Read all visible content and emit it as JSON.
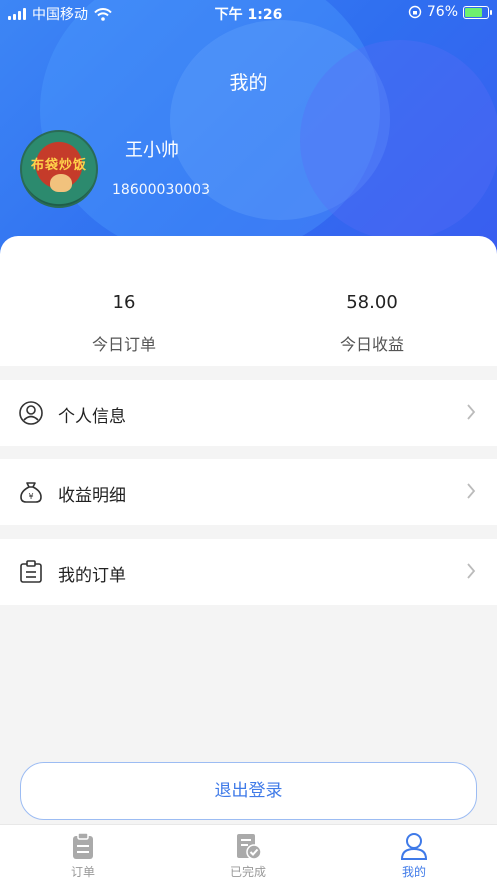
{
  "status_bar": {
    "carrier": "中国移动",
    "time": "下午 1:26",
    "battery": "76%"
  },
  "header": {
    "title": "我的"
  },
  "user": {
    "avatar_text": "布袋炒饭",
    "name": "王小帅",
    "phone": "18600030003"
  },
  "stats": [
    {
      "value": "16",
      "label": "今日订单"
    },
    {
      "value": "58.00",
      "label": "今日收益"
    }
  ],
  "menu": [
    {
      "label": "个人信息",
      "icon": "user-circle-icon"
    },
    {
      "label": "收益明细",
      "icon": "money-bag-icon"
    },
    {
      "label": "我的订单",
      "icon": "clipboard-list-icon"
    }
  ],
  "logout_label": "退出登录",
  "tabs": [
    {
      "label": "订单",
      "icon": "clipboard-icon"
    },
    {
      "label": "已完成",
      "icon": "document-check-icon"
    },
    {
      "label": "我的",
      "icon": "user-icon",
      "active": true
    }
  ],
  "colors": {
    "primary": "#3f7ae8",
    "header_gradient_start": "#3d86f5",
    "header_gradient_end": "#3a5df0",
    "inactive_tab": "#999999"
  }
}
